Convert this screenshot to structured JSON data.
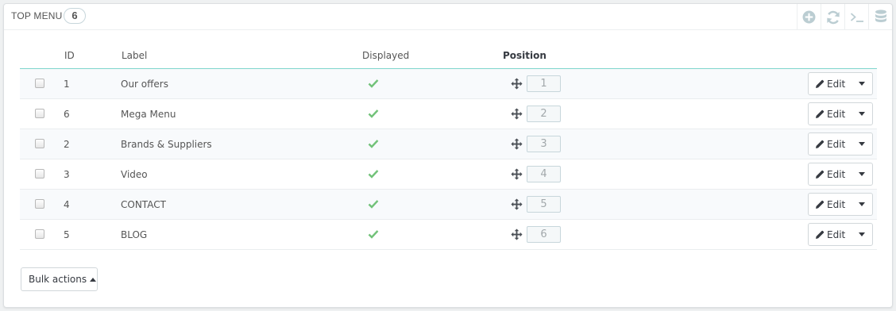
{
  "panel": {
    "title": "Top Menu",
    "count": "6"
  },
  "toolbar": {
    "icons": [
      "add-circle-icon",
      "refresh-icon",
      "terminal-icon",
      "database-icon"
    ]
  },
  "table": {
    "headers": {
      "id": "ID",
      "label": "Label",
      "displayed": "Displayed",
      "position": "Position"
    },
    "rows": [
      {
        "id": "1",
        "label": "Our offers",
        "position": "1",
        "edit": "Edit"
      },
      {
        "id": "6",
        "label": "Mega Menu",
        "position": "2",
        "edit": "Edit"
      },
      {
        "id": "2",
        "label": "Brands & Suppliers",
        "position": "3",
        "edit": "Edit"
      },
      {
        "id": "3",
        "label": "Video",
        "position": "4",
        "edit": "Edit"
      },
      {
        "id": "4",
        "label": "CONTACT",
        "position": "5",
        "edit": "Edit"
      },
      {
        "id": "5",
        "label": "BLOG",
        "position": "6",
        "edit": "Edit"
      }
    ]
  },
  "bulk": {
    "label": "Bulk actions"
  },
  "colors": {
    "check": "#72c279",
    "header_border": "#7fd5cd",
    "toolbar_icon": "#bbcdd2"
  }
}
